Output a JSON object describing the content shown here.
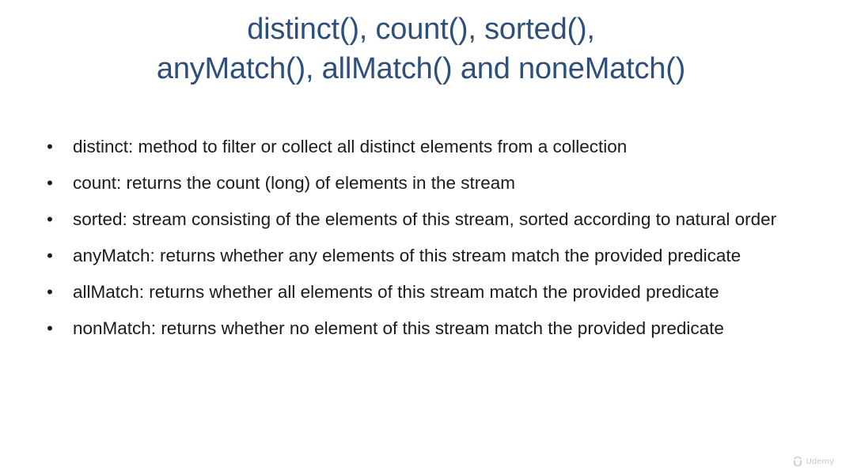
{
  "slide": {
    "title_lines": [
      "distinct(), count(), sorted(),",
      "anyMatch(), allMatch() and noneMatch()"
    ],
    "bullets": [
      "distinct: method to filter or collect all distinct elements from a collection",
      "count: returns the count (long) of elements in the stream",
      "sorted: stream consisting of the elements of this stream, sorted according to natural order",
      "anyMatch: returns whether any elements of this stream match the provided predicate",
      "allMatch: returns whether all elements of this stream match the provided predicate",
      "nonMatch: returns whether no element of this stream match the provided predicate"
    ],
    "bullet_symbol": "•"
  },
  "watermark": {
    "text": "Udemy",
    "icon": "udemy-logo-icon"
  },
  "colors": {
    "title": "#2e4f7c",
    "body_text": "#1b1b1b",
    "background": "#ffffff",
    "watermark": "#9a9a9a"
  }
}
